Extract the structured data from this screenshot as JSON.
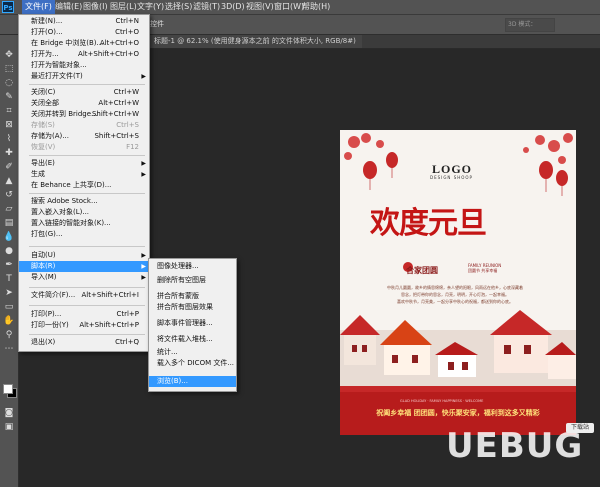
{
  "menubar": {
    "items": [
      "文件(F)",
      "编辑(E)",
      "图像(I)",
      "图层(L)",
      "文字(Y)",
      "选择(S)",
      "滤镜(T)",
      "3D(D)",
      "视图(V)",
      "窗口(W)",
      "帮助(H)"
    ],
    "active_index": 0
  },
  "options_bar": {
    "hint": "控件",
    "mode_3d": "3D 模式："
  },
  "document_tab": {
    "title": "标题-1 @ 62.1% (使用健身源本之前 的文件体积大小, RGB/8#)"
  },
  "file_menu": {
    "items": [
      {
        "label": "新建(N)...",
        "shortcut": "Ctrl+N"
      },
      {
        "label": "打开(O)...",
        "shortcut": "Ctrl+O"
      },
      {
        "label": "在 Bridge 中浏览(B)...",
        "shortcut": "Alt+Ctrl+O"
      },
      {
        "label": "打开为...",
        "shortcut": "Alt+Shift+Ctrl+O"
      },
      {
        "label": "打开为智能对象..."
      },
      {
        "label": "最近打开文件(T)",
        "submenu": true
      },
      {
        "label": "关闭(C)",
        "shortcut": "Ctrl+W"
      },
      {
        "label": "关闭全部",
        "shortcut": "Alt+Ctrl+W"
      },
      {
        "label": "关闭并转到 Bridge...",
        "shortcut": "Shift+Ctrl+W"
      },
      {
        "label": "存储(S)",
        "shortcut": "Ctrl+S",
        "disabled": true
      },
      {
        "label": "存储为(A)...",
        "shortcut": "Shift+Ctrl+S"
      },
      {
        "label": "恢复(V)",
        "shortcut": "F12",
        "disabled": true
      },
      {
        "label": "导出(E)",
        "submenu": true
      },
      {
        "label": "生成",
        "submenu": true
      },
      {
        "label": "在 Behance 上共享(D)..."
      },
      {
        "label": "搜索 Adobe Stock..."
      },
      {
        "label": "置入嵌入对象(L)..."
      },
      {
        "label": "置入链接的智能对象(K)..."
      },
      {
        "label": "打包(G)..."
      },
      {
        "label": "自动(U)",
        "submenu": true
      },
      {
        "label": "脚本(R)",
        "submenu": true
      },
      {
        "label": "导入(M)",
        "submenu": true
      },
      {
        "label": "文件简介(F)...",
        "shortcut": "Alt+Shift+Ctrl+I"
      },
      {
        "label": "打印(P)...",
        "shortcut": "Ctrl+P"
      },
      {
        "label": "打印一份(Y)",
        "shortcut": "Alt+Shift+Ctrl+P"
      },
      {
        "label": "退出(X)",
        "shortcut": "Ctrl+Q"
      }
    ],
    "highlighted_index": 20
  },
  "scripts_submenu": {
    "items": [
      "图像处理器...",
      "删除所有空图层",
      "拼合所有蒙版",
      "拼合所有图层效果",
      "脚本事件管理器...",
      "将文件载入堆栈...",
      "统计...",
      "载入多个 DICOM 文件...",
      "浏览(B)..."
    ],
    "highlighted_index": 8
  },
  "poster": {
    "logo": "LOGO",
    "logo_sub": "DESIGN SHOOP",
    "title": "欢度元旦",
    "slogan": "合家团圆",
    "slogan_en": [
      "FAMILY REUNION",
      "团圆节 共享幸福"
    ],
    "copy_lines": [
      "中秋月儿圆圆，故乡的情思绵绵，亲人望的阳眼，风雨远在他乡，心底深藏着",
      "思念，把灯带你的思念，月亮，明明，开心灯泡，一起幸福。",
      "喜欢中秋节，月亮美，一起分享中秋心的祝福，都送到你的心底。"
    ],
    "band_en": "GLAD HOLIDAY · FAMILY HAPPINESS · WELCOME",
    "band_text": "祝阖乡幸福 团团圆，快乐聚安家，福利到这多又精彩"
  },
  "watermark": {
    "brand": "UEBUG",
    "badge": "下载站"
  },
  "colors": {
    "accent": "#3399ff",
    "poster_red": "#c41515"
  }
}
